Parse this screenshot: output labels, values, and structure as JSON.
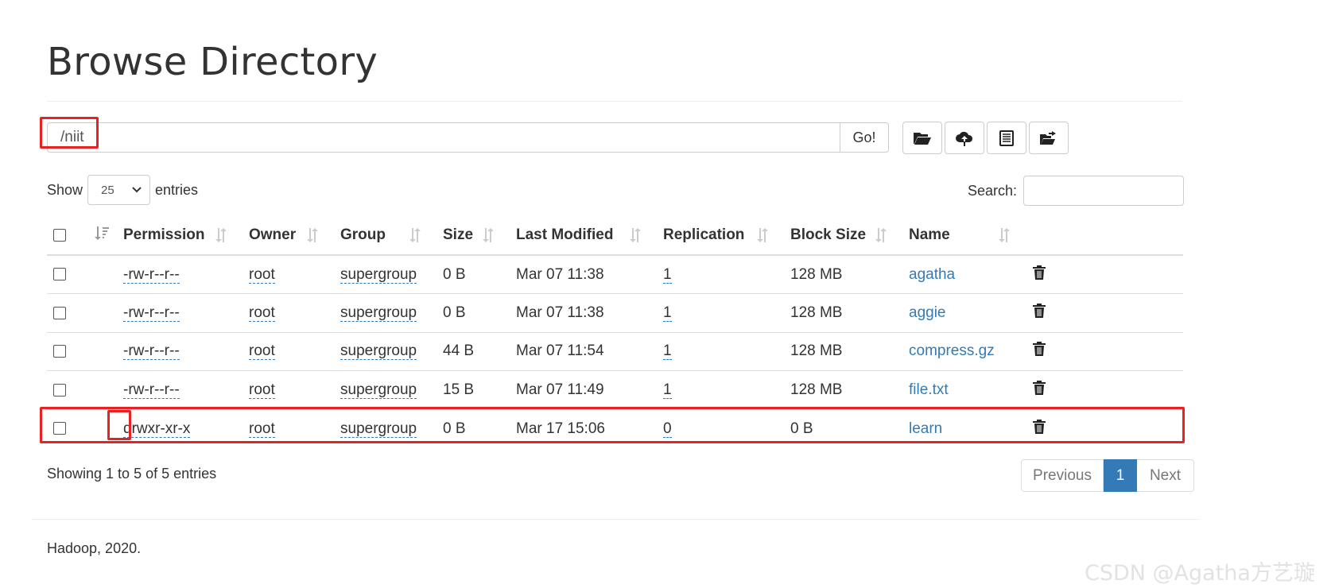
{
  "page": {
    "title": "Browse Directory"
  },
  "path_bar": {
    "value": "/niit",
    "go_label": "Go!"
  },
  "toolbar": [
    {
      "name": "create-directory-button",
      "icon": "folder-open-icon"
    },
    {
      "name": "upload-button",
      "icon": "cloud-upload-icon"
    },
    {
      "name": "list-view-button",
      "icon": "list-alt-icon"
    },
    {
      "name": "move-button",
      "icon": "folder-move-icon"
    }
  ],
  "length": {
    "show_label": "Show",
    "value": "25",
    "entries_label": "entries"
  },
  "search": {
    "label": "Search:",
    "value": ""
  },
  "table": {
    "headers": [
      "Permission",
      "Owner",
      "Group",
      "Size",
      "Last Modified",
      "Replication",
      "Block Size",
      "Name"
    ],
    "rows": [
      {
        "permission": "-rw-r--r--",
        "owner": "root",
        "group": "supergroup",
        "size": "0 B",
        "modified": "Mar 07 11:38",
        "replication": "1",
        "block_size": "128 MB",
        "name": "agatha"
      },
      {
        "permission": "-rw-r--r--",
        "owner": "root",
        "group": "supergroup",
        "size": "0 B",
        "modified": "Mar 07 11:38",
        "replication": "1",
        "block_size": "128 MB",
        "name": "aggie"
      },
      {
        "permission": "-rw-r--r--",
        "owner": "root",
        "group": "supergroup",
        "size": "44 B",
        "modified": "Mar 07 11:54",
        "replication": "1",
        "block_size": "128 MB",
        "name": "compress.gz"
      },
      {
        "permission": "-rw-r--r--",
        "owner": "root",
        "group": "supergroup",
        "size": "15 B",
        "modified": "Mar 07 11:49",
        "replication": "1",
        "block_size": "128 MB",
        "name": "file.txt"
      },
      {
        "permission": "drwxr-xr-x",
        "owner": "root",
        "group": "supergroup",
        "size": "0 B",
        "modified": "Mar 17 15:06",
        "replication": "0",
        "block_size": "0 B",
        "name": "learn"
      }
    ]
  },
  "info": "Showing 1 to 5 of 5 entries",
  "pagination": {
    "previous": "Previous",
    "current": "1",
    "next": "Next"
  },
  "footer": "Hadoop, 2020.",
  "watermark": "CSDN @Agatha方艺璇",
  "colors": {
    "link": "#337ab7",
    "highlight": "#e62222",
    "active_page": "#337ab7"
  }
}
